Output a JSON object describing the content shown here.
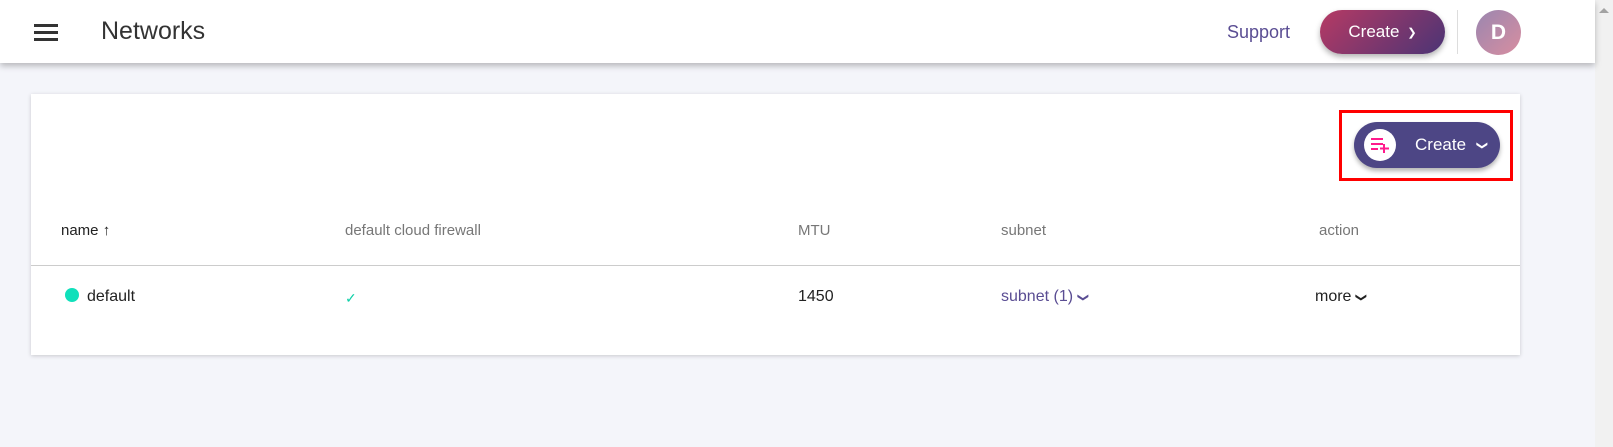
{
  "header": {
    "title": "Networks",
    "support": "Support",
    "create": "Create",
    "avatar_letter": "D"
  },
  "card": {
    "create": "Create"
  },
  "table": {
    "columns": [
      "name",
      "default cloud firewall",
      "MTU",
      "subnet",
      "action"
    ],
    "sort_indicator": "↑",
    "rows": [
      {
        "name": "default",
        "status_color": "#10e0bb",
        "firewall": "✓",
        "mtu": "1450",
        "subnet": "subnet (1)",
        "action": "more"
      }
    ]
  }
}
